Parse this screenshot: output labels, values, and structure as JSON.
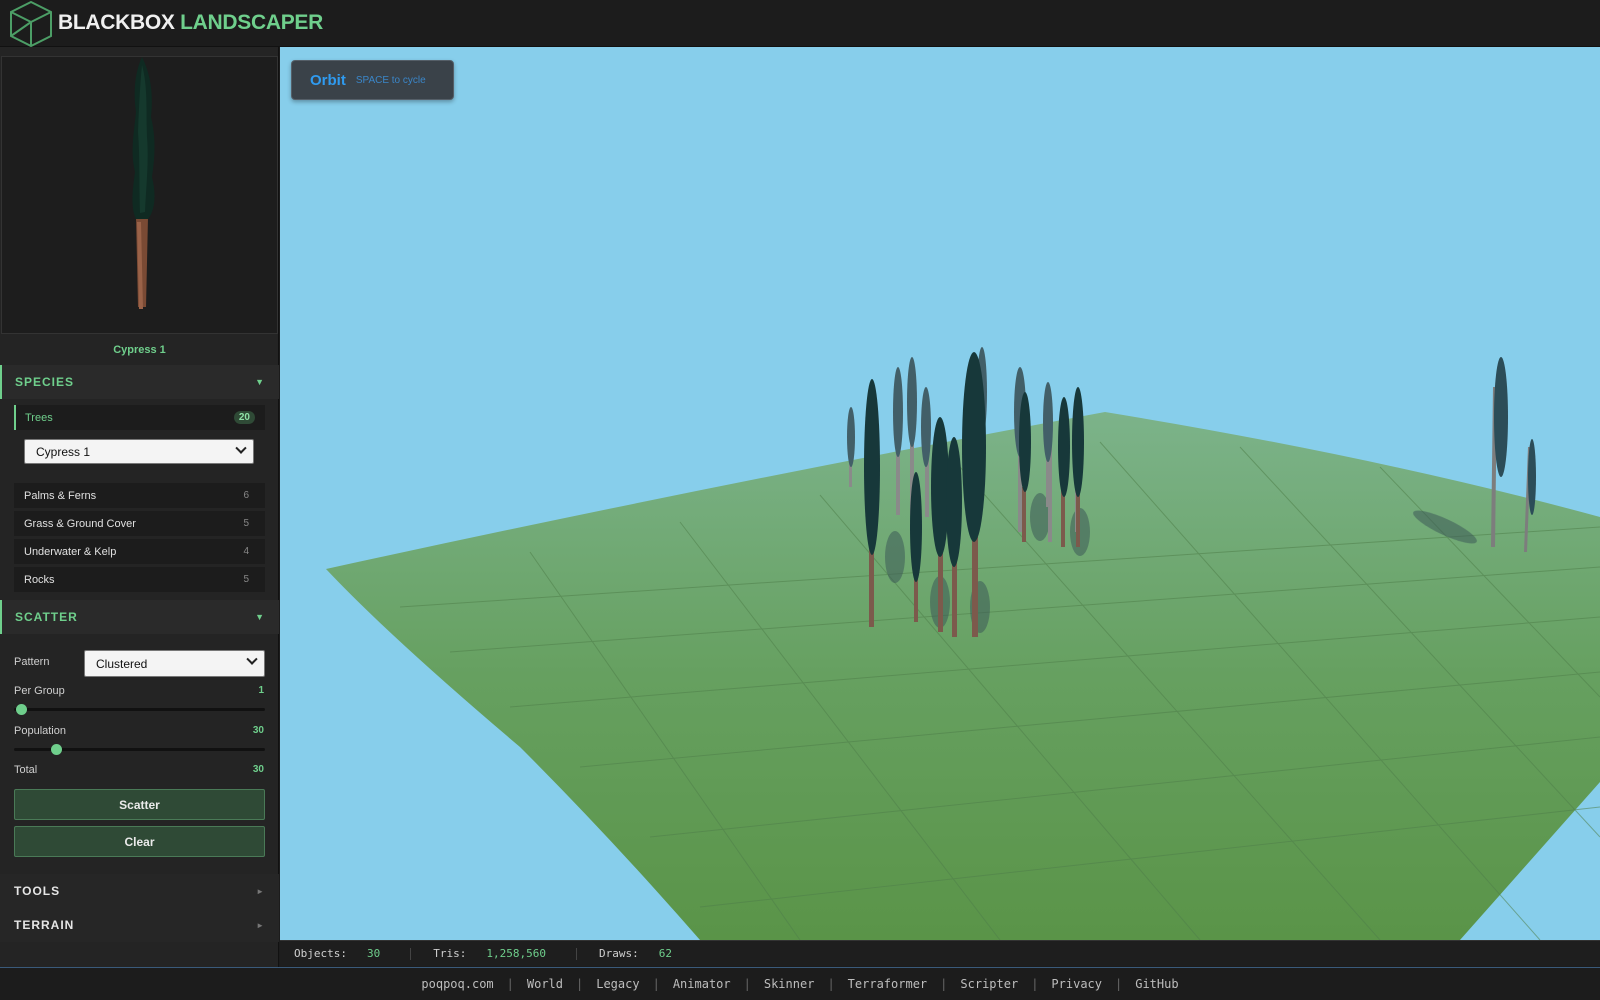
{
  "brand": {
    "part1": "BLACKBOX",
    "part2": "LANDSCAPER"
  },
  "preview": {
    "name": "Cypress 1"
  },
  "species": {
    "title": "SPECIES",
    "categories": [
      {
        "label": "Trees",
        "count": "20"
      },
      {
        "label": "Palms & Ferns",
        "count": "6"
      },
      {
        "label": "Grass & Ground Cover",
        "count": "5"
      },
      {
        "label": "Underwater & Kelp",
        "count": "4"
      },
      {
        "label": "Rocks",
        "count": "5"
      }
    ],
    "selected_species": "Cypress 1"
  },
  "scatter": {
    "title": "SCATTER",
    "pattern_label": "Pattern",
    "pattern_value": "Clustered",
    "per_group_label": "Per Group",
    "per_group_value": "1",
    "population_label": "Population",
    "population_value": "30",
    "total_label": "Total",
    "total_value": "30",
    "scatter_button": "Scatter",
    "clear_button": "Clear"
  },
  "tools": {
    "title": "TOOLS"
  },
  "terrain": {
    "title": "TERRAIN"
  },
  "viewport": {
    "mode": "Orbit",
    "hint": "SPACE to cycle"
  },
  "stats": {
    "objects_label": "Objects:",
    "objects_value": "30",
    "tris_label": "Tris:",
    "tris_value": "1,258,560",
    "draws_label": "Draws:",
    "draws_value": "62"
  },
  "footer": {
    "links": [
      "poqpoq.com",
      "World",
      "Legacy",
      "Animator",
      "Skinner",
      "Terraformer",
      "Scripter",
      "Privacy",
      "GitHub"
    ]
  },
  "colors": {
    "accent": "#6fcf8c",
    "sky": "#87ceeb",
    "ground": "#5f9a55",
    "mode_blue": "#2f9bf0"
  }
}
